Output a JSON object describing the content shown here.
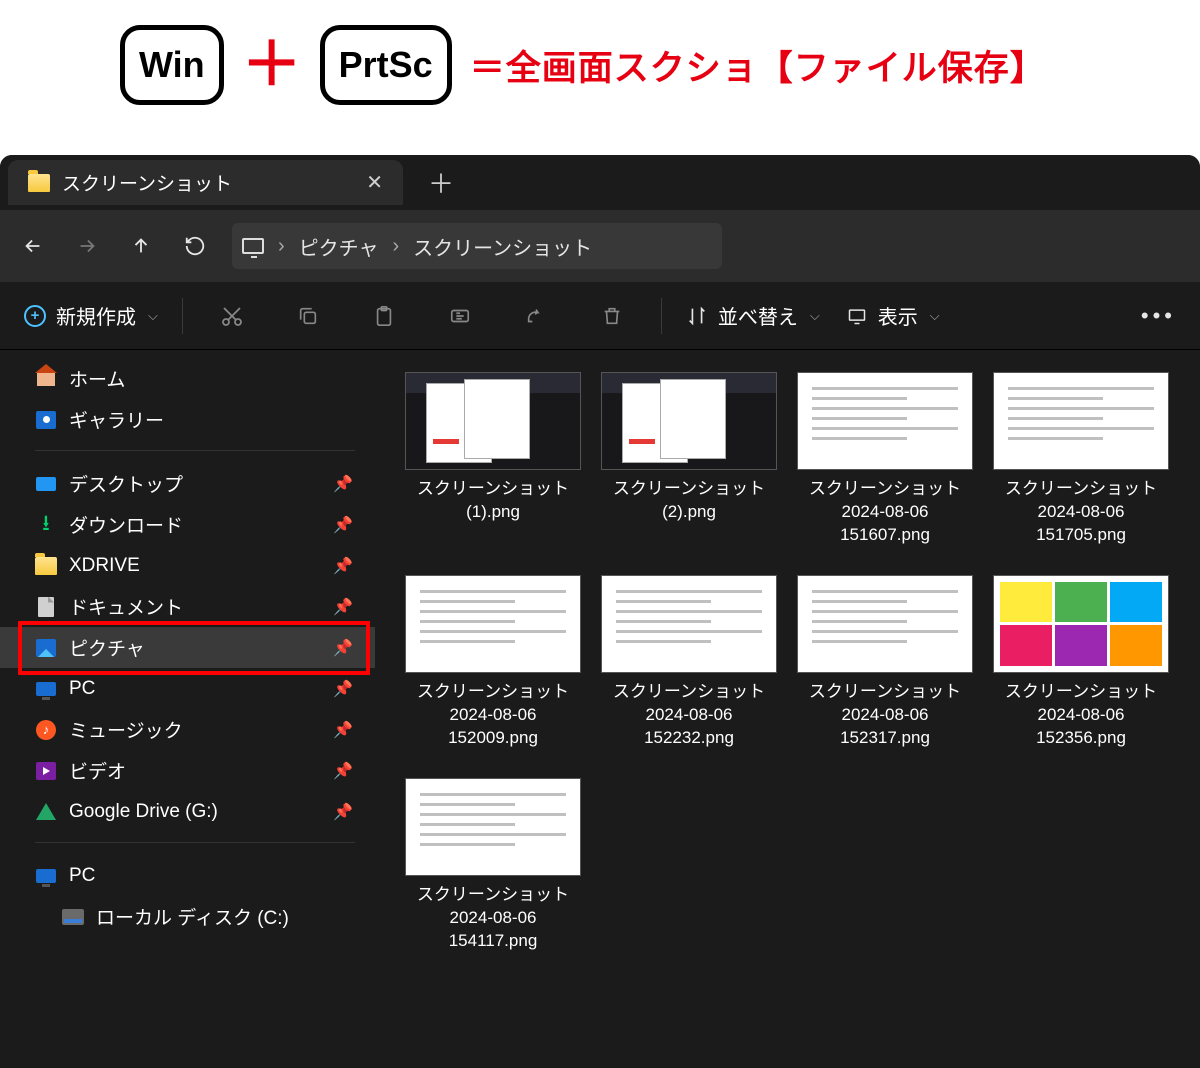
{
  "banner": {
    "key1": "Win",
    "key2": "PrtSc",
    "text": "＝全画面スクショ【ファイル保存】"
  },
  "tab": {
    "title": "スクリーンショット"
  },
  "breadcrumb": {
    "seg1": "ピクチャ",
    "seg2": "スクリーンショット"
  },
  "toolbar": {
    "new": "新規作成",
    "sort": "並べ替え",
    "view": "表示"
  },
  "sidebar": {
    "home": "ホーム",
    "gallery": "ギャラリー",
    "desktop": "デスクトップ",
    "downloads": "ダウンロード",
    "xdrive": "XDRIVE",
    "documents": "ドキュメント",
    "pictures": "ピクチャ",
    "pc": "PC",
    "music": "ミュージック",
    "video": "ビデオ",
    "gdrive": "Google Drive (G:)",
    "pc2": "PC",
    "localdisk": "ローカル ディスク (C:)"
  },
  "files": [
    {
      "name": "スクリーンショット (1).png",
      "kind": "dark"
    },
    {
      "name": "スクリーンショット (2).png",
      "kind": "dark"
    },
    {
      "name": "スクリーンショット 2024-08-06 151607.png",
      "kind": "doc"
    },
    {
      "name": "スクリーンショット 2024-08-06 151705.png",
      "kind": "doc"
    },
    {
      "name": "スクリーンショット 2024-08-06 152009.png",
      "kind": "doc"
    },
    {
      "name": "スクリーンショット 2024-08-06 152232.png",
      "kind": "doc"
    },
    {
      "name": "スクリーンショット 2024-08-06 152317.png",
      "kind": "doc"
    },
    {
      "name": "スクリーンショット 2024-08-06 152356.png",
      "kind": "color"
    },
    {
      "name": "スクリーンショット 2024-08-06 154117.png",
      "kind": "doc"
    }
  ]
}
